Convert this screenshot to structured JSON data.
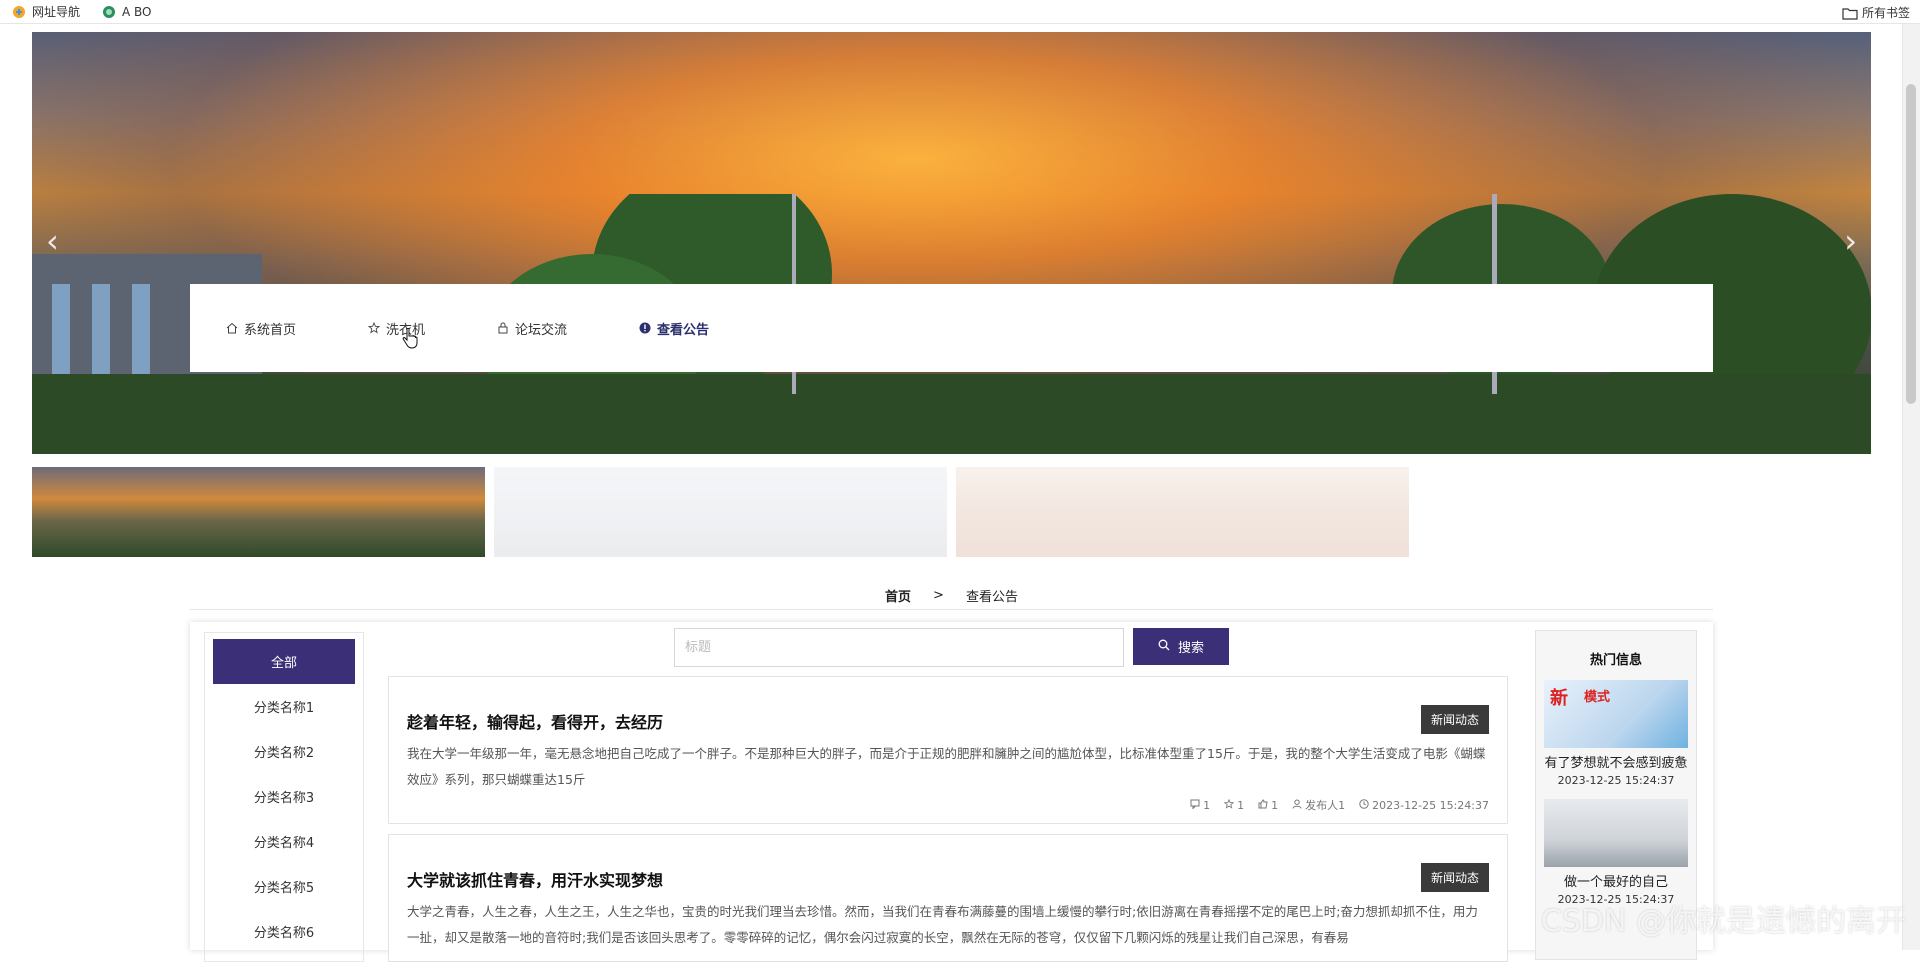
{
  "bookmarks": {
    "items": [
      {
        "label": "网址导航",
        "icon": "nav-icon"
      },
      {
        "label": "A BO",
        "icon": "globe-icon"
      }
    ],
    "all_label": "所有书签"
  },
  "banner": {
    "prev": "‹",
    "next": "›"
  },
  "nav": {
    "items": [
      {
        "label": "系统首页",
        "icon": "home-icon"
      },
      {
        "label": "洗衣机",
        "icon": "star-icon"
      },
      {
        "label": "论坛交流",
        "icon": "lock-icon"
      },
      {
        "label": "查看公告",
        "icon": "info-icon"
      }
    ]
  },
  "breadcrumb": {
    "home": "首页",
    "separator": ">",
    "current": "查看公告"
  },
  "categories": [
    "全部",
    "分类名称1",
    "分类名称2",
    "分类名称3",
    "分类名称4",
    "分类名称5",
    "分类名称6"
  ],
  "search": {
    "placeholder": "标题",
    "button": "搜索"
  },
  "articles": [
    {
      "title": "趁着年轻，输得起，看得开，去经历",
      "tag": "新闻动态",
      "body": "我在大学一年级那一年，毫无悬念地把自己吃成了一个胖子。不是那种巨大的胖子，而是介于正规的肥胖和臃肿之间的尴尬体型，比标准体型重了15斤。于是，我的整个大学生活变成了电影《蝴蝶效应》系列，那只蝴蝶重达15斤",
      "comments": "1",
      "stars": "1",
      "likes": "1",
      "author": "发布人1",
      "time": "2023-12-25 15:24:37"
    },
    {
      "title": "大学就该抓住青春，用汗水实现梦想",
      "tag": "新闻动态",
      "body": "大学之青春，人生之春，人生之王，人生之华也，宝贵的时光我们理当去珍惜。然而，当我们在青春布满藤蔓的围墙上缓慢的攀行时;依旧游离在青春摇摆不定的尾巴上时;奋力想抓却抓不住，用力一扯，却又是散落一地的音符时;我们是否该回头思考了。零零碎碎的记忆，偶尔会闪过寂寞的长空，飘然在无际的苍穹，仅仅留下几颗闪烁的残星让我们自己深思，有春易",
      "comments": "",
      "stars": "",
      "likes": "",
      "author": "",
      "time": ""
    }
  ],
  "hot": {
    "title": "热门信息",
    "items": [
      {
        "caption": "有了梦想就不会感到疲惫",
        "date": "2023-12-25 15:24:37",
        "img_text_1": "新",
        "img_text_2": "模式"
      },
      {
        "caption": "做一个最好的自己",
        "date": "2023-12-25 15:24:37"
      }
    ]
  },
  "watermark": "CSDN @你就是遗憾的离开"
}
